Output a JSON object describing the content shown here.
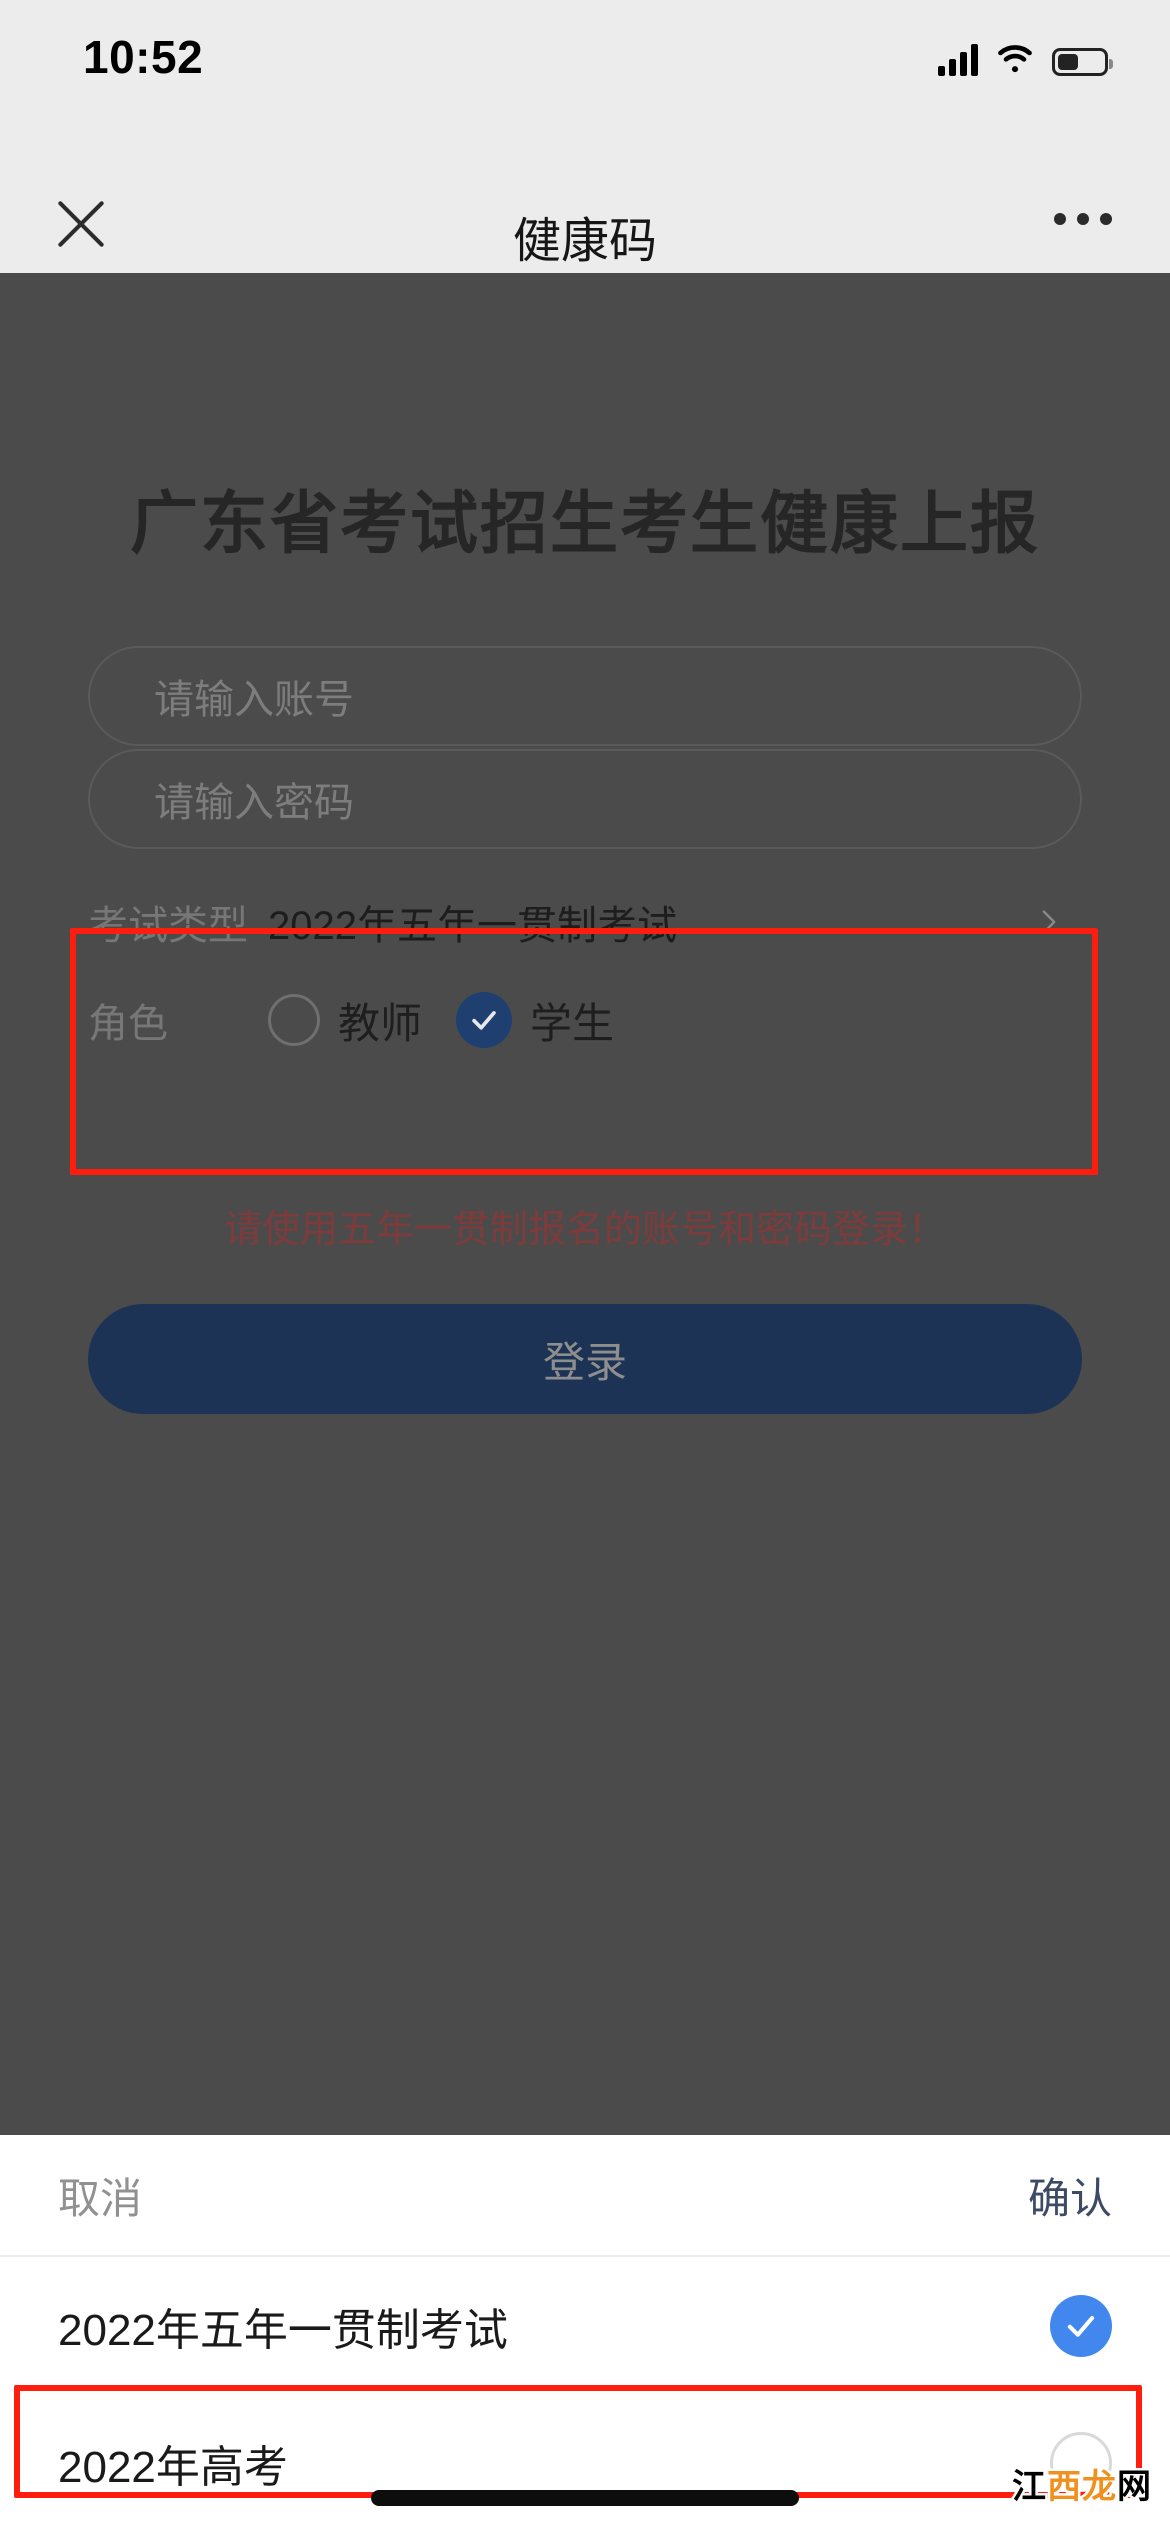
{
  "status_bar": {
    "time": "10:52",
    "signal_icon": "signal-bars-icon",
    "wifi_icon": "wifi-icon",
    "battery_icon": "battery-icon",
    "battery_level_pct": 40
  },
  "nav_bar": {
    "close_icon": "close-icon",
    "title": "健康码",
    "more_icon": "more-dots-icon"
  },
  "page": {
    "title": "广东省考试招生考生健康上报",
    "account_field": {
      "value": "",
      "placeholder": "请输入账号"
    },
    "password_field": {
      "value": "",
      "placeholder": "请输入密码"
    },
    "exam_type_row": {
      "label": "考试类型",
      "value": "2022年五年一贯制考试",
      "chevron_icon": "chevron-right-icon"
    },
    "role_row": {
      "label": "角色",
      "options": [
        {
          "label": "教师",
          "selected": false
        },
        {
          "label": "学生",
          "selected": true
        }
      ]
    },
    "hint": "请使用五年一贯制报名的账号和密码登录！",
    "login_button": "登录"
  },
  "sheet": {
    "cancel": "取消",
    "confirm": "确认",
    "options": [
      {
        "label": "2022年五年一贯制考试",
        "selected": true
      },
      {
        "label": "2022年高考",
        "selected": false
      }
    ]
  },
  "annotations": {
    "form_box_color": "#ff1d0d",
    "option_box_color": "#ff1d0d"
  },
  "watermark": {
    "part1": "江",
    "part2": "西",
    "part3": "龙",
    "part4": "网"
  },
  "colors": {
    "accent_blue": "#4187ee",
    "login_navy": "#1d3356",
    "radio_navy": "#1e3f70",
    "hint_red": "#7e3b3b",
    "chrome_gray": "#ececec",
    "dim_overlay": "#4b4b4b"
  }
}
